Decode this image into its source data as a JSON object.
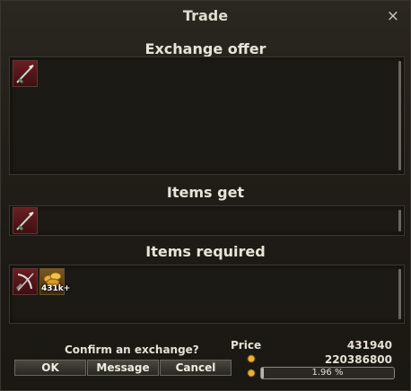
{
  "window": {
    "title": "Trade",
    "close_icon": "×"
  },
  "sections": {
    "offer_title": "Exchange offer",
    "get_title": "Items get",
    "required_title": "Items required"
  },
  "slots": {
    "offer": [
      {
        "icon": "spear-icon"
      }
    ],
    "get": [
      {
        "icon": "spear-icon"
      }
    ],
    "required": [
      {
        "icon": "crossbow-icon"
      },
      {
        "icon": "gold-coins-icon",
        "badge": "431k+"
      }
    ]
  },
  "footer": {
    "confirm_text": "Confirm an exchange?",
    "ok_label": "OK",
    "message_label": "Message",
    "cancel_label": "Cancel",
    "price_label": "Price",
    "price_value": "431940",
    "gold_value": "220386800",
    "progress_text": "1.96 %",
    "progress_percent": 1.96
  },
  "colors": {
    "slot_red": "#6a1e22",
    "text": "#e6e1d4"
  }
}
